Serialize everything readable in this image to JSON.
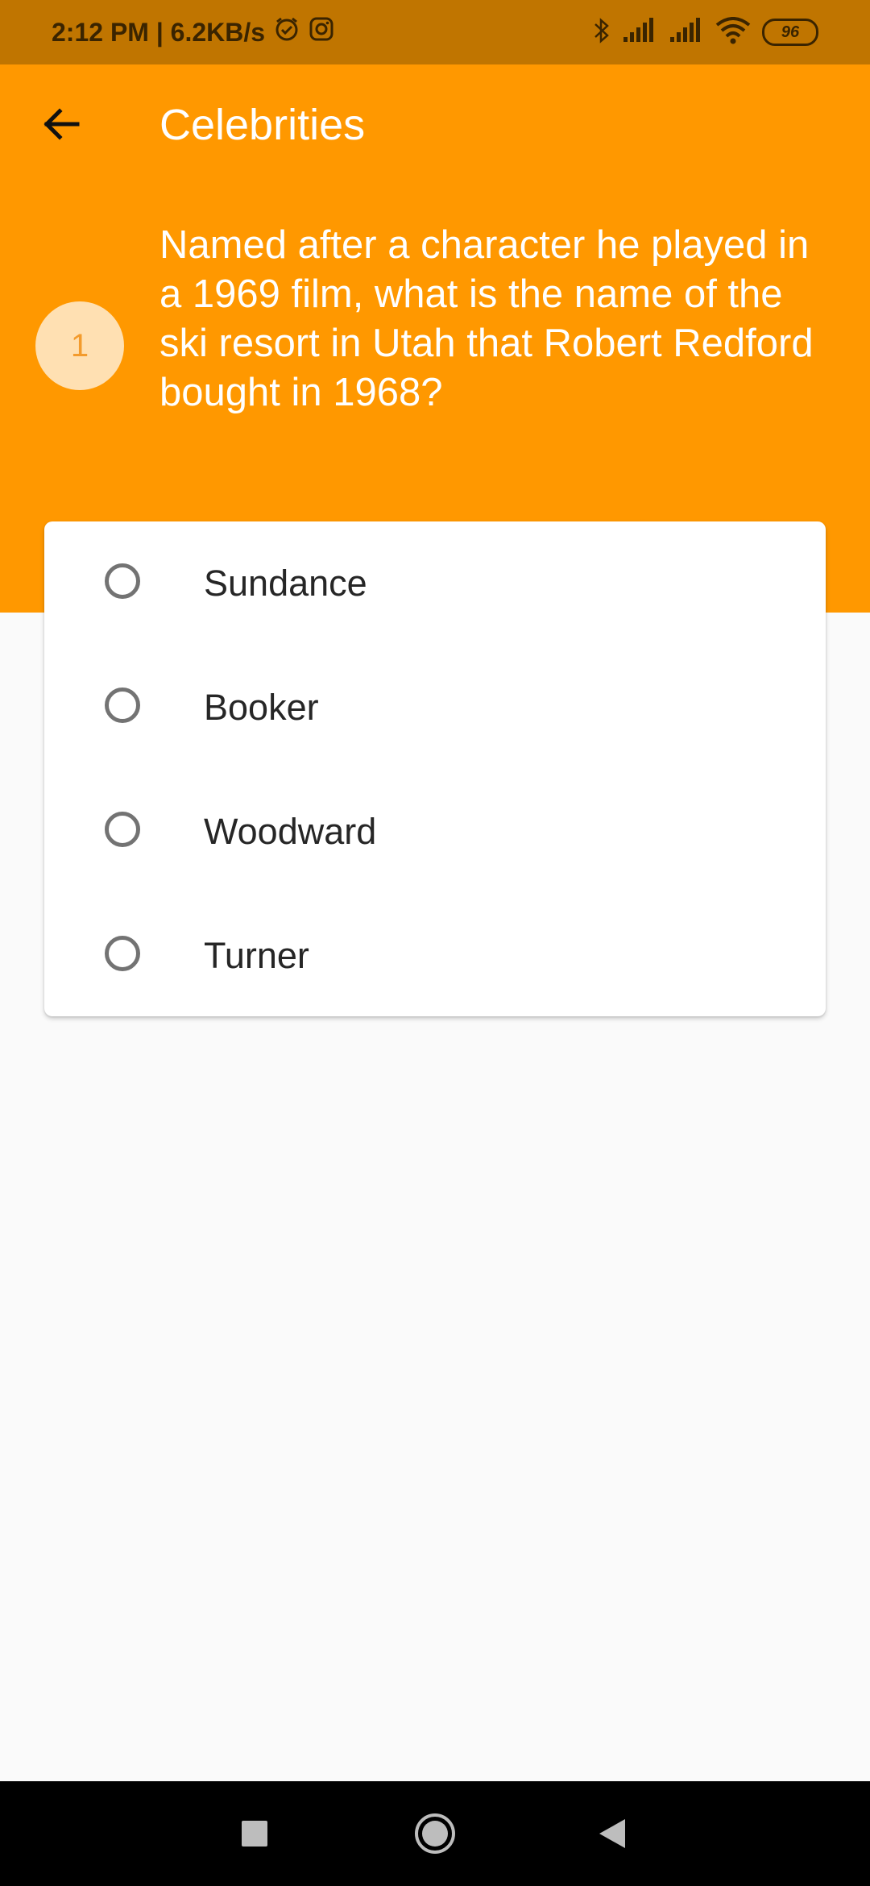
{
  "status_bar": {
    "time_speed": "2:12 PM | 6.2KB/s",
    "battery_level": "96",
    "icons": [
      "alarm-icon",
      "instagram-icon",
      "bluetooth-icon",
      "signal-icon",
      "signal-icon",
      "wifi-icon",
      "battery-icon"
    ]
  },
  "header": {
    "title": "Celebrities",
    "back_icon": "arrow-left-icon",
    "accent_color": "#ff9800"
  },
  "question": {
    "number": "1",
    "text": "Named after a character he played in a 1969 film, what is the name of the ski resort in Utah that Robert Redford bought in 1968?"
  },
  "options": [
    {
      "label": "Sundance",
      "selected": false
    },
    {
      "label": "Booker",
      "selected": false
    },
    {
      "label": "Woodward",
      "selected": false
    },
    {
      "label": "Turner",
      "selected": false
    }
  ],
  "nav_bar": {
    "buttons": [
      "recents-square-icon",
      "home-circle-icon",
      "back-triangle-icon"
    ]
  }
}
